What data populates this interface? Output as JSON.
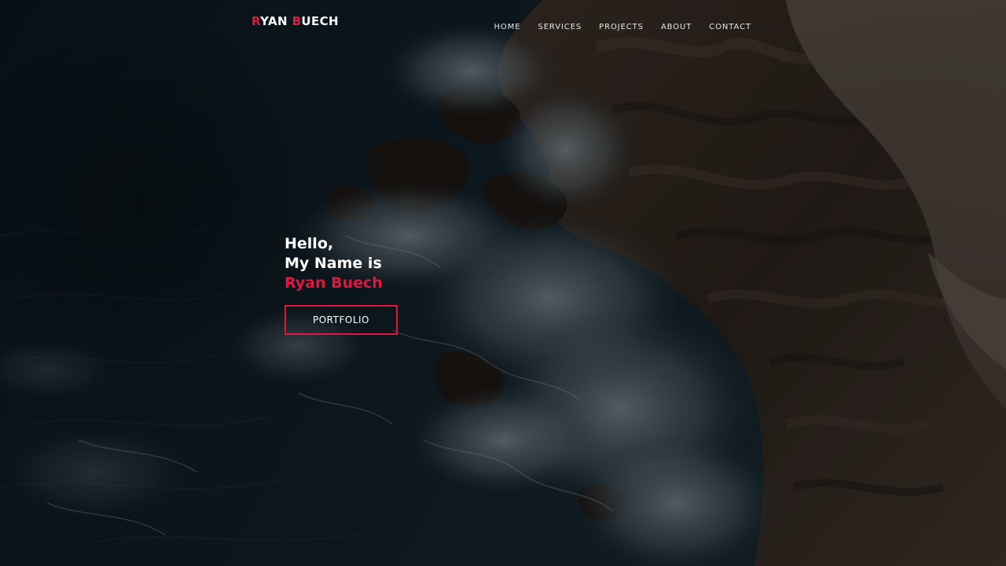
{
  "theme": {
    "accent": "#e0173e",
    "text": "#ffffff",
    "background": "#0c1419"
  },
  "brand": {
    "first_initial": "R",
    "first_rest": "YAN ",
    "last_initial": "B",
    "last_rest": "UECH"
  },
  "nav": {
    "items": [
      {
        "label": "HOME"
      },
      {
        "label": "SERVICES"
      },
      {
        "label": "PROJECTS"
      },
      {
        "label": "ABOUT"
      },
      {
        "label": "CONTACT"
      }
    ]
  },
  "hero": {
    "greeting": "Hello,",
    "intro": "My Name is",
    "name": "Ryan Buech",
    "button_label": "PORTFOLIO"
  }
}
